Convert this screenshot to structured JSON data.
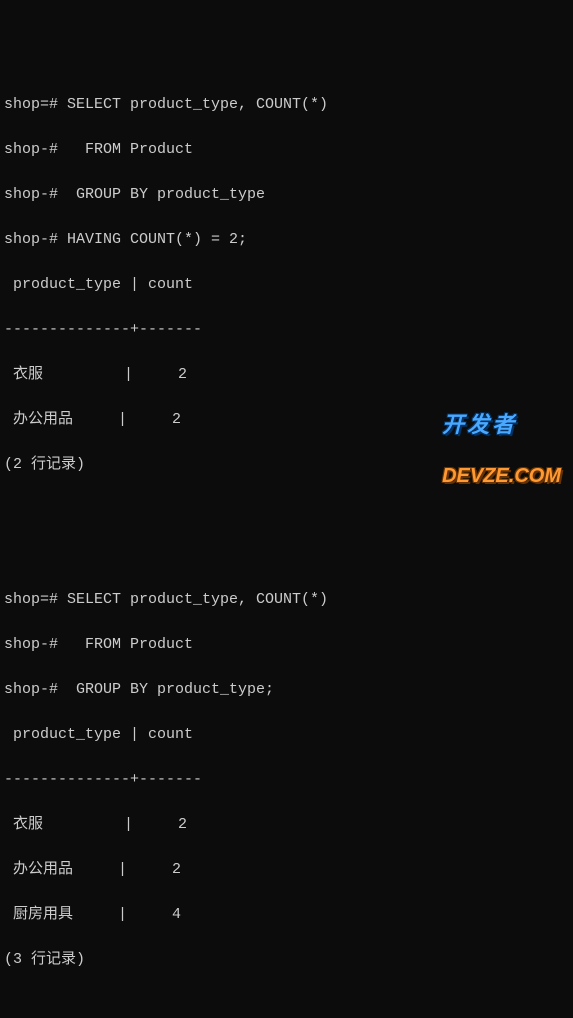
{
  "query1": {
    "lines": [
      "shop=# SELECT product_type, COUNT(*)",
      "shop-#   FROM Product",
      "shop-#  GROUP BY product_type",
      "shop-# HAVING COUNT(*) = 2;"
    ],
    "header": " product_type | count",
    "divider": "--------------+-------",
    "rows": [
      " 衣服         |     2",
      " 办公用品     |     2"
    ],
    "footer": "(2 行记录)"
  },
  "query2": {
    "lines": [
      "shop=# SELECT product_type, COUNT(*)",
      "shop-#   FROM Product",
      "shop-#  GROUP BY product_type;"
    ],
    "header": " product_type | count",
    "divider": "--------------+-------",
    "rows": [
      " 衣服         |     2",
      " 办公用品     |     2",
      " 厨房用具     |     4"
    ],
    "footer": "(3 行记录)"
  },
  "watermark": {
    "top": "开发者",
    "bottom": "DEVZE.COM"
  }
}
